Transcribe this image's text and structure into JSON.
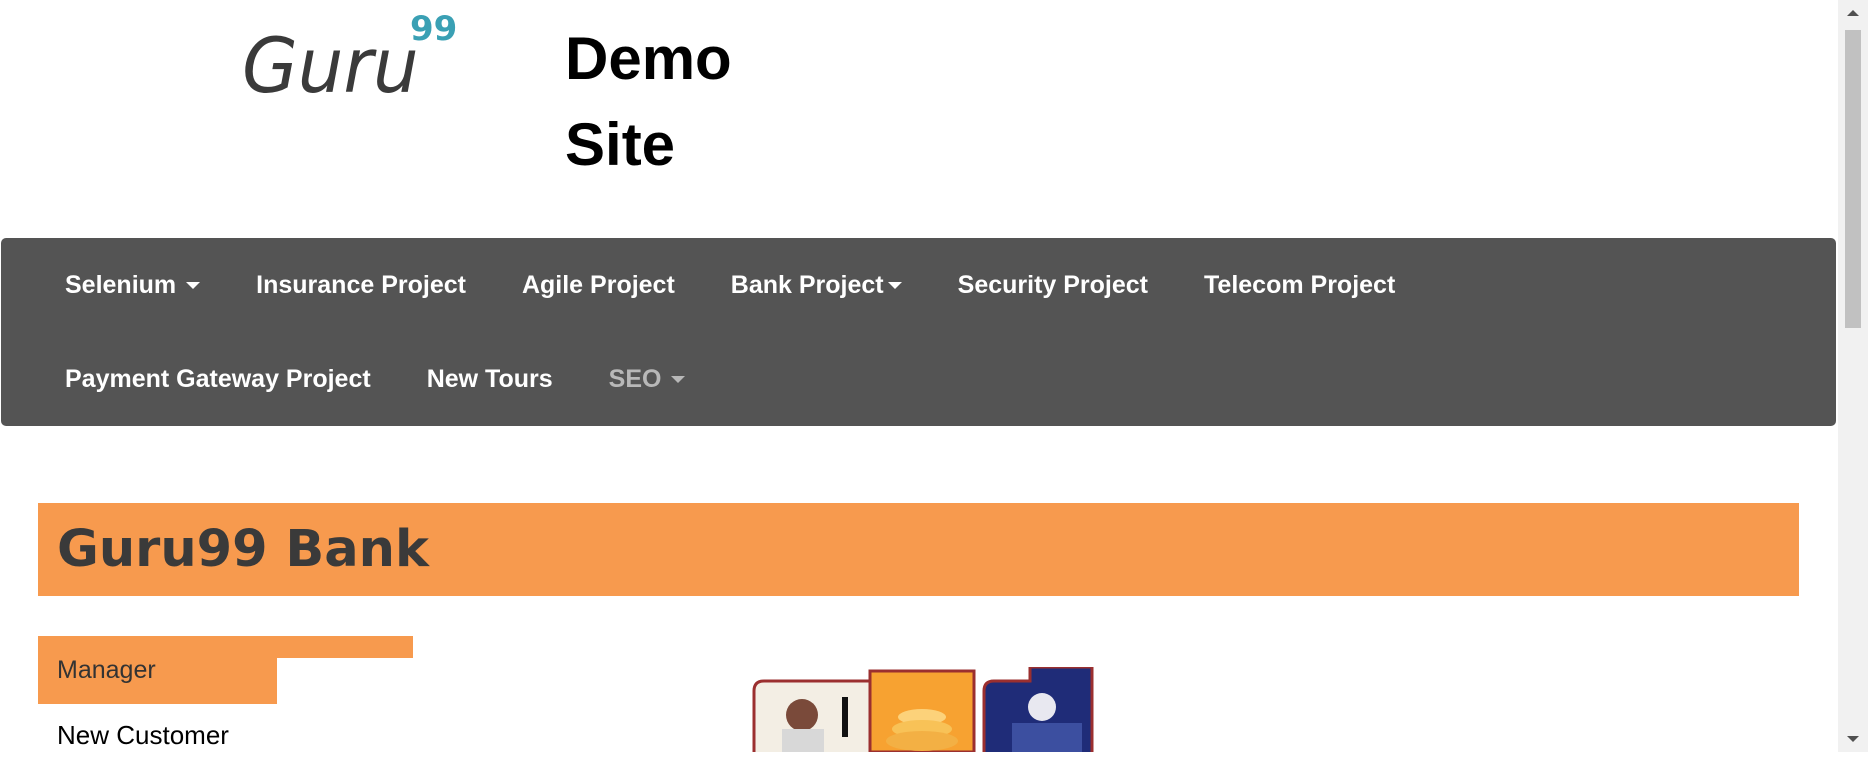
{
  "header": {
    "logo_text": "Guru",
    "logo_superscript": "99",
    "title_line1": "Demo",
    "title_line2": "Site"
  },
  "nav": {
    "row1": [
      {
        "label": "Selenium",
        "dropdown": true
      },
      {
        "label": "Insurance Project",
        "dropdown": false
      },
      {
        "label": "Agile Project",
        "dropdown": false
      },
      {
        "label": "Bank Project",
        "dropdown": true
      },
      {
        "label": "Security Project",
        "dropdown": false
      },
      {
        "label": "Telecom Project",
        "dropdown": false
      }
    ],
    "row2": [
      {
        "label": "Payment Gateway Project",
        "dropdown": false
      },
      {
        "label": "New Tours",
        "dropdown": false
      },
      {
        "label": "SEO",
        "dropdown": true
      }
    ]
  },
  "bank": {
    "title": "Guru99 Bank"
  },
  "sidebar": {
    "heading": "Manager",
    "items": [
      "New Customer"
    ]
  },
  "colors": {
    "nav_bg": "#545454",
    "accent_orange": "#f79a4e",
    "logo_teal": "#3aa0b4"
  },
  "icons": {
    "nav_dropdown": "caret-down-icon",
    "scroll_up": "arrow-up-icon",
    "scroll_down": "arrow-down-icon"
  }
}
